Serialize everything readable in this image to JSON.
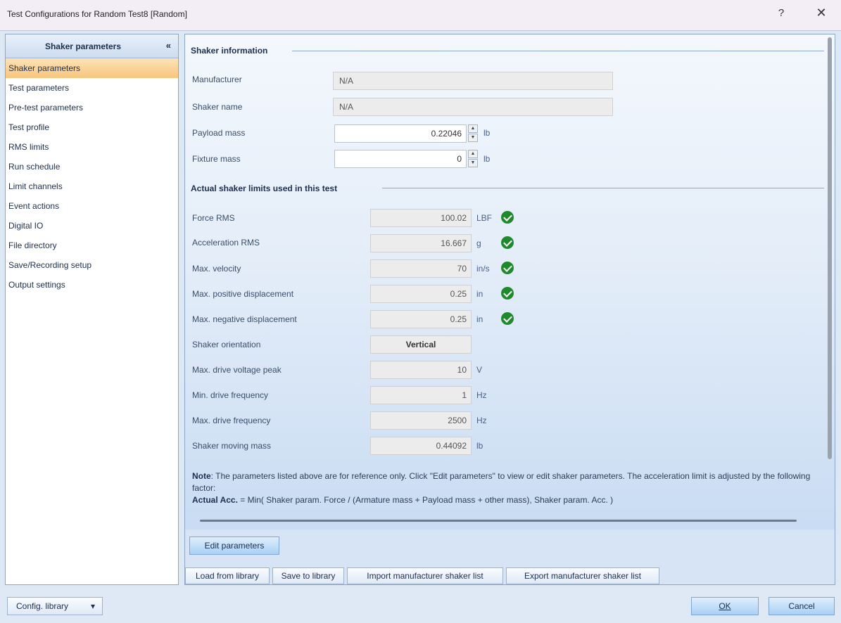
{
  "window": {
    "title": "Test Configurations for Random Test8 [Random]",
    "help_label": "?",
    "close_label": "✕"
  },
  "sidebar": {
    "header": "Shaker parameters",
    "collapse_label": "«",
    "items": [
      {
        "label": "Shaker parameters"
      },
      {
        "label": "Test parameters"
      },
      {
        "label": "Pre-test parameters"
      },
      {
        "label": "Test profile"
      },
      {
        "label": "RMS limits"
      },
      {
        "label": "Run schedule"
      },
      {
        "label": "Limit channels"
      },
      {
        "label": "Event actions"
      },
      {
        "label": "Digital IO"
      },
      {
        "label": "File directory"
      },
      {
        "label": "Save/Recording setup"
      },
      {
        "label": "Output settings"
      }
    ]
  },
  "shaker_info": {
    "section_title": "Shaker information",
    "manufacturer": {
      "label": "Manufacturer",
      "value": "N/A"
    },
    "shaker_name": {
      "label": "Shaker name",
      "value": "N/A"
    },
    "payload_mass": {
      "label": "Payload mass",
      "value": "0.22046",
      "unit": "lb"
    },
    "fixture_mass": {
      "label": "Fixture mass",
      "value": "0",
      "unit": "lb"
    }
  },
  "limits": {
    "section_title": "Actual shaker limits used in this test",
    "rows": [
      {
        "label": "Force RMS",
        "value": "100.02",
        "unit": "LBF",
        "ok": true
      },
      {
        "label": "Acceleration RMS",
        "value": "16.667",
        "unit": "g",
        "ok": true
      },
      {
        "label": "Max. velocity",
        "value": "70",
        "unit": "in/s",
        "ok": true
      },
      {
        "label": "Max. positive displacement",
        "value": "0.25",
        "unit": "in",
        "ok": true
      },
      {
        "label": "Max. negative displacement",
        "value": "0.25",
        "unit": "in",
        "ok": true
      },
      {
        "label": "Shaker orientation",
        "value": "Vertical",
        "unit": "",
        "ok": false
      },
      {
        "label": "Max. drive voltage peak",
        "value": "10",
        "unit": "V",
        "ok": false
      },
      {
        "label": "Min. drive frequency",
        "value": "1",
        "unit": "Hz",
        "ok": false
      },
      {
        "label": "Max. drive frequency",
        "value": "2500",
        "unit": "Hz",
        "ok": false
      },
      {
        "label": "Shaker moving mass",
        "value": "0.44092",
        "unit": "lb",
        "ok": false
      }
    ]
  },
  "note": {
    "prefix": "Note",
    "text": ": The parameters listed above are for reference only. Click \"Edit parameters\" to view or edit shaker parameters. The acceleration limit is adjusted by the following factor:",
    "formula_label": "Actual Acc.",
    "formula": " = Min( Shaker param. Force / (Armature mass + Payload mass + other mass), Shaker param. Acc. )"
  },
  "buttons": {
    "edit_parameters": "Edit parameters",
    "load_from_library": "Load from library",
    "save_to_library": "Save to library",
    "import_list": "Import manufacturer shaker list",
    "export_list": "Export manufacturer shaker list",
    "config_library": "Config. library",
    "config_library_arrow": "▾",
    "ok": "OK",
    "cancel": "Cancel"
  }
}
